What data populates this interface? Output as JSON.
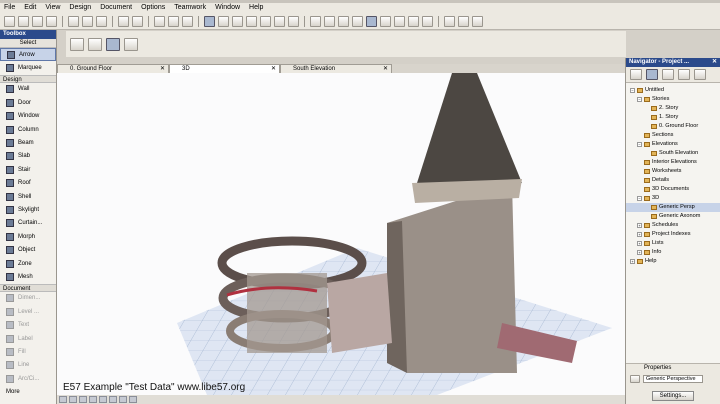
{
  "menu": [
    "File",
    "Edit",
    "View",
    "Design",
    "Document",
    "Options",
    "Teamwork",
    "Window",
    "Help"
  ],
  "toolbox": {
    "title": "Toolbox",
    "select": "Select",
    "tools": [
      {
        "label": "Arrow",
        "icon": "arrow-icon",
        "active": true
      },
      {
        "label": "Marquee",
        "icon": "marquee-icon"
      }
    ],
    "design_section": "Design",
    "design_tools": [
      "Wall",
      "Door",
      "Window",
      "Column",
      "Beam",
      "Slab",
      "Stair",
      "Roof",
      "Shell",
      "Skylight",
      "Curtain...",
      "Morph",
      "Object",
      "Zone",
      "Mesh"
    ],
    "document_section": "Document",
    "document_tools": [
      "Dimen...",
      "Level ...",
      "Text",
      "Label",
      "Fill",
      "Line",
      "Arc/Ci..."
    ],
    "more": "More"
  },
  "tabs": [
    {
      "label": "0. Ground Floor",
      "active": false
    },
    {
      "label": "3D",
      "active": true
    },
    {
      "label": "South Elevation",
      "active": false
    }
  ],
  "viewport": {
    "watermark": "E57 Example \"Test Data\" www.libe57.org"
  },
  "navigator": {
    "title": "Navigator - Project ...",
    "tree": [
      {
        "label": "Untitled",
        "level": 0
      },
      {
        "label": "Stories",
        "level": 1
      },
      {
        "label": "2. Story",
        "level": 2
      },
      {
        "label": "1. Story",
        "level": 2
      },
      {
        "label": "0. Ground Floor",
        "level": 2
      },
      {
        "label": "Sections",
        "level": 1
      },
      {
        "label": "Elevations",
        "level": 1
      },
      {
        "label": "South Elevation",
        "level": 2
      },
      {
        "label": "Interior Elevations",
        "level": 1
      },
      {
        "label": "Worksheets",
        "level": 1
      },
      {
        "label": "Details",
        "level": 1
      },
      {
        "label": "3D Documents",
        "level": 1
      },
      {
        "label": "3D",
        "level": 1
      },
      {
        "label": "Generic Persp",
        "level": 2,
        "selected": true
      },
      {
        "label": "Generic Axonom",
        "level": 2
      },
      {
        "label": "Schedules",
        "level": 1
      },
      {
        "label": "Project Indexes",
        "level": 1
      },
      {
        "label": "Lists",
        "level": 1
      },
      {
        "label": "Info",
        "level": 1
      },
      {
        "label": "Help",
        "level": 0
      }
    ],
    "properties_title": "Properties",
    "properties_value": "Generic Perspective",
    "settings_label": "Settings..."
  }
}
